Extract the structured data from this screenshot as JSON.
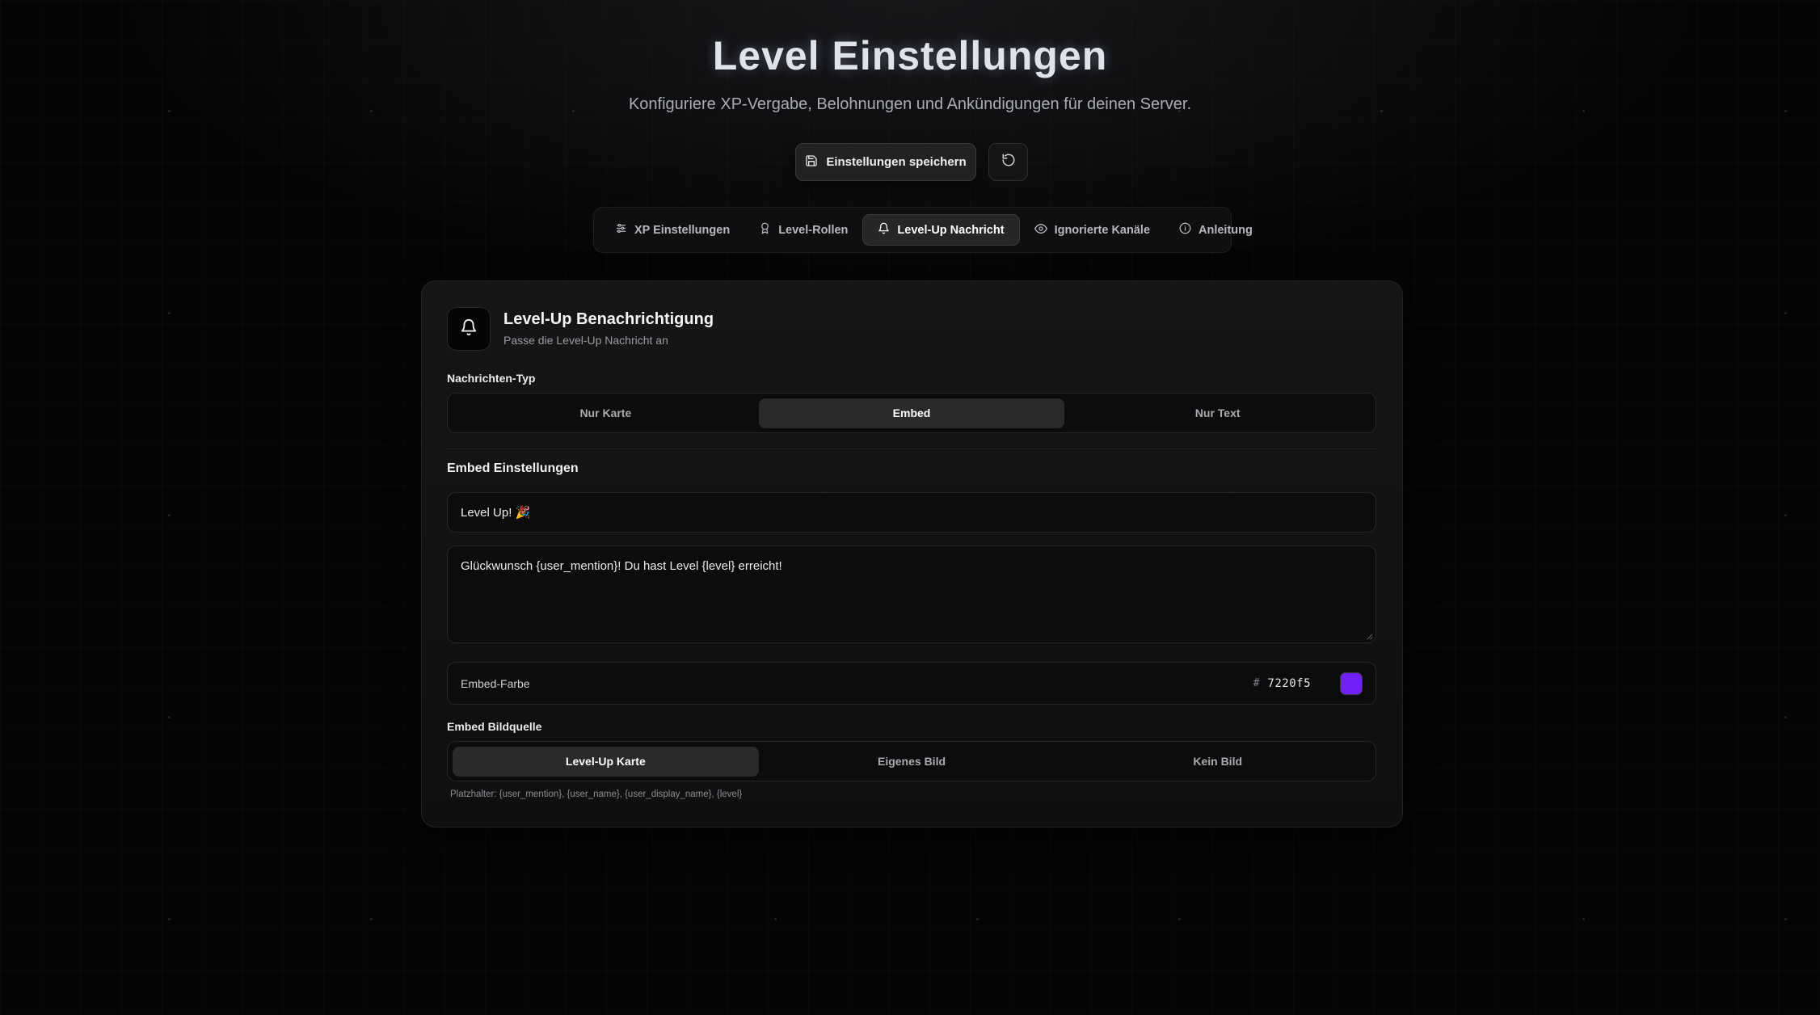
{
  "header": {
    "title": "Level Einstellungen",
    "subtitle": "Konfiguriere XP-Vergabe, Belohnungen und Ankündigungen für deinen Server."
  },
  "actions": {
    "save_label": "Einstellungen speichern",
    "save_icon": "save-icon",
    "reset_icon": "reset-icon"
  },
  "tabs": [
    {
      "label": "XP Einstellungen",
      "icon": "sliders-icon"
    },
    {
      "label": "Level-Rollen",
      "icon": "award-icon"
    },
    {
      "label": "Level-Up Nachricht",
      "icon": "bell-icon",
      "active": true
    },
    {
      "label": "Ignorierte Kanäle",
      "icon": "eye-icon"
    },
    {
      "label": "Anleitung",
      "icon": "info-icon"
    }
  ],
  "card": {
    "title": "Level-Up Benachrichtigung",
    "subtitle": "Passe die Level-Up Nachricht an",
    "icon": "bell-icon"
  },
  "message_type": {
    "label": "Nachrichten-Typ",
    "options": [
      "Nur Karte",
      "Embed",
      "Nur Text"
    ],
    "selected": "Embed"
  },
  "embed": {
    "section_title": "Embed Einstellungen",
    "title_value": "Level Up! 🎉",
    "description_value": "Glückwunsch {user_mention}! Du hast Level {level} erreicht!",
    "color_label": "Embed-Farbe",
    "color_hash": "#",
    "color_hex": "7220f5",
    "color_value": "#7220f5"
  },
  "image_source": {
    "label": "Embed Bildquelle",
    "options": [
      "Level-Up Karte",
      "Eigenes Bild",
      "Kein Bild"
    ],
    "selected": "Level-Up Karte"
  },
  "placeholder_hint": "Platzhalter: {user_mention}, {user_name}, {user_display_name}, {level}"
}
